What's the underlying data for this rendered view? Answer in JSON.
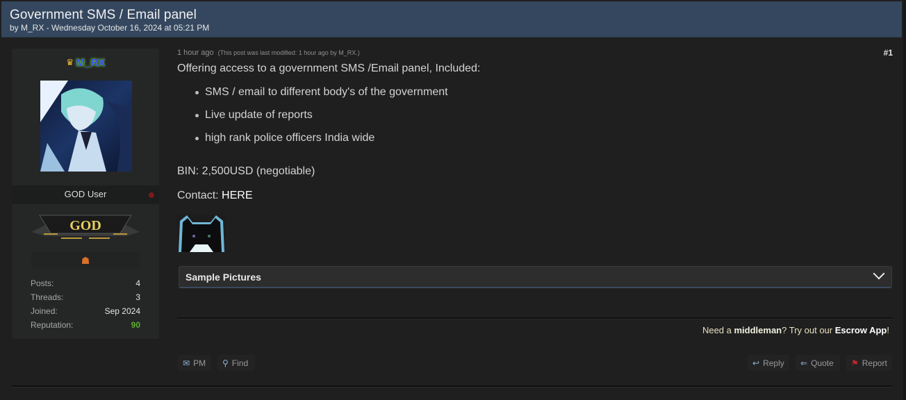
{
  "thread": {
    "title": "Government SMS / Email panel",
    "meta": "by M_RX - Wednesday October 16, 2024 at 05:21 PM"
  },
  "user": {
    "rank_icon": "crown-icon",
    "username": "M_RX",
    "user_title": "GOD User",
    "badge_text": "GOD",
    "award_icon": "award-icon",
    "stats": [
      {
        "label": "Posts:",
        "value": "4"
      },
      {
        "label": "Threads:",
        "value": "3"
      },
      {
        "label": "Joined:",
        "value": "Sep 2024"
      },
      {
        "label": "Reputation:",
        "value": "90"
      }
    ],
    "colors": {
      "username": "#3a4af0",
      "username_glow": "#6bd13a",
      "reputation": "#5cae32"
    }
  },
  "post": {
    "time": "1 hour ago",
    "modified_note": "(This post was last modified: 1 hour ago by M_RX.)",
    "number": "#1",
    "intro": "Offering access to a government SMS /Email panel, Included:",
    "features": [
      "SMS / email to different body's of the government",
      "Live update of reports",
      "high rank police officers India wide"
    ],
    "bin": "BIN: 2,500USD (negotiable)",
    "contact_label": "Contact: ",
    "contact_link": "HERE",
    "spoiler_label": "Sample Pictures"
  },
  "signature": {
    "part1": "Need a ",
    "part2": "middleman",
    "part3": "? Try out our ",
    "part4": "Escrow App",
    "part5": "!"
  },
  "buttons": {
    "pm": "PM",
    "find": "Find",
    "reply": "Reply",
    "quote": "Quote",
    "report": "Report"
  },
  "colors": {
    "header_bg": "#34475f",
    "page_bg": "#1f1f1f",
    "report_icon": "#c0282a"
  }
}
